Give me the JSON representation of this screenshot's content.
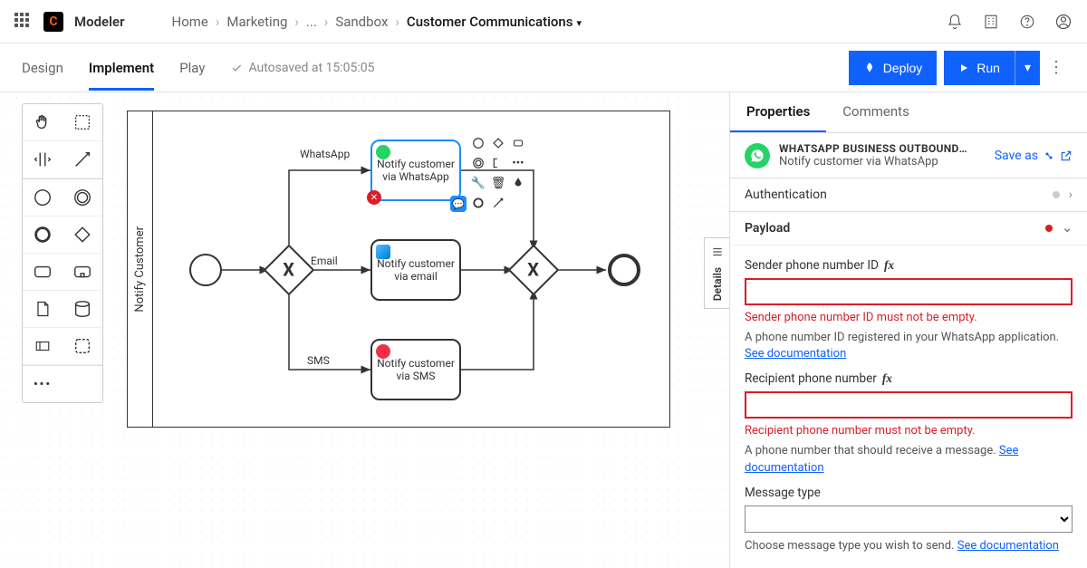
{
  "app": {
    "name": "Modeler",
    "logo_letter": "C"
  },
  "breadcrumbs": {
    "items": [
      "Home",
      "Marketing",
      "...",
      "Sandbox"
    ],
    "current": "Customer Communications"
  },
  "tabs": {
    "design": "Design",
    "implement": "Implement",
    "play": "Play"
  },
  "autosave": "Autosaved at 15:05:05",
  "buttons": {
    "deploy": "Deploy",
    "run": "Run"
  },
  "lane": "Notify Customer",
  "edges": {
    "whatsapp": "WhatsApp",
    "email": "Email",
    "sms": "SMS"
  },
  "tasks": {
    "whatsapp": "Notify customer via WhatsApp",
    "email": "Notify customer via email",
    "sms": "Notify customer via SMS"
  },
  "details_tab": "Details",
  "panel": {
    "tabs": {
      "properties": "Properties",
      "comments": "Comments"
    },
    "connector_type": "WHATSAPP BUSINESS OUTBOUND C…",
    "connector_name": "Notify customer via WhatsApp",
    "save_as": "Save as",
    "sections": {
      "auth": "Authentication",
      "payload": "Payload"
    },
    "fields": {
      "sender": {
        "label": "Sender phone number ID",
        "error": "Sender phone number ID must not be empty.",
        "help_pre": "A phone number ID registered in your WhatsApp application. ",
        "help_link": "See documentation"
      },
      "recipient": {
        "label": "Recipient phone number",
        "error": "Recipient phone number must not be empty.",
        "help_pre": "A phone number that should receive a message. ",
        "help_link": "See documentation"
      },
      "msgtype": {
        "label": "Message type",
        "help_pre": "Choose message type you wish to send. ",
        "help_link": "See documentation"
      }
    }
  }
}
